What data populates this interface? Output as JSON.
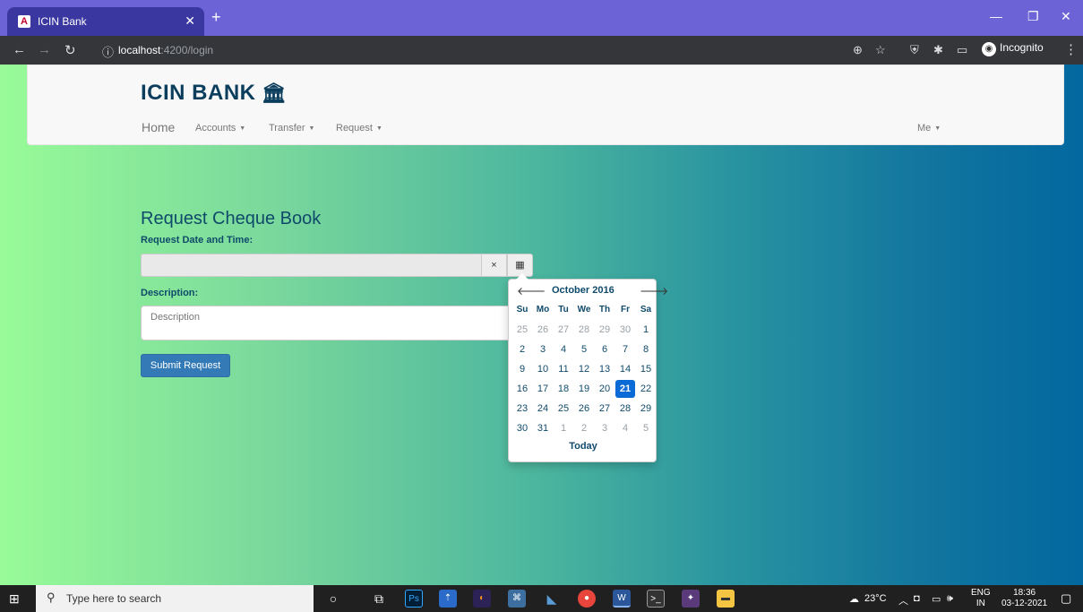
{
  "browser": {
    "tab_title": "ICIN Bank",
    "tab_favicon": "A",
    "new_tab": "+",
    "url_host": "localhost",
    "url_path": ":4200/login",
    "incognito_label": "Incognito"
  },
  "navbar": {
    "brand": "ICIN BANK",
    "brand_icon": "bank-icon",
    "items": [
      {
        "label": "Home"
      },
      {
        "label": "Accounts"
      },
      {
        "label": "Transfer"
      },
      {
        "label": "Request"
      }
    ],
    "right_menu": "Me"
  },
  "form": {
    "title": "Request Cheque Book",
    "date_label": "Request Date and Time:",
    "date_value": "",
    "clear_symbol": "×",
    "calendar_icon": "calendar-icon",
    "description_label": "Description:",
    "description_placeholder": "Description",
    "submit_label": "Submit Request"
  },
  "datepicker": {
    "month": "October 2016",
    "prev": "🡐",
    "next": "🡒",
    "weekdays": [
      "Su",
      "Mo",
      "Tu",
      "We",
      "Th",
      "Fr",
      "Sa"
    ],
    "weeks": [
      [
        "25",
        "26",
        "27",
        "28",
        "29",
        "30",
        "1"
      ],
      [
        "2",
        "3",
        "4",
        "5",
        "6",
        "7",
        "8"
      ],
      [
        "9",
        "10",
        "11",
        "12",
        "13",
        "14",
        "15"
      ],
      [
        "16",
        "17",
        "18",
        "19",
        "20",
        "21",
        "22"
      ],
      [
        "23",
        "24",
        "25",
        "26",
        "27",
        "28",
        "29"
      ],
      [
        "30",
        "31",
        "1",
        "2",
        "3",
        "4",
        "5"
      ]
    ],
    "selected": "21",
    "today_label": "Today"
  },
  "taskbar": {
    "search_placeholder": "Type here to search",
    "weather": "23°C",
    "language": "ENG",
    "region": "IN",
    "time": "18:36",
    "date": "03-12-2021"
  },
  "colors": {
    "accent": "#337ab7",
    "selected_day": "#0a6ad6",
    "brand": "#0b3d5c"
  }
}
